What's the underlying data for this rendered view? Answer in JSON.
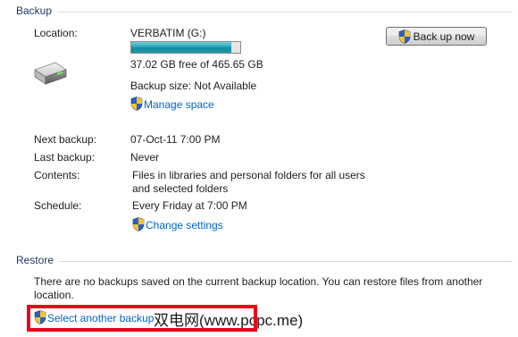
{
  "backup_section": {
    "title": "Backup",
    "location_label": "Location:",
    "drive_name": "VERBATIM (G:)",
    "free_space": "37.02 GB free of 465.65 GB",
    "usage_fraction": 0.92,
    "backup_size": "Backup size: Not Available",
    "manage_space_link": "Manage space",
    "backup_now_button": "Back up now",
    "next_backup_label": "Next backup:",
    "next_backup_value": "07-Oct-11 7:00 PM",
    "last_backup_label": "Last backup:",
    "last_backup_value": "Never",
    "contents_label": "Contents:",
    "contents_value_line1": "Files in libraries and personal folders for all users",
    "contents_value_line2": "and selected folders",
    "schedule_label": "Schedule:",
    "schedule_value": "Every Friday at 7:00 PM",
    "change_settings_link": "Change settings"
  },
  "restore_section": {
    "title": "Restore",
    "message_line1": "There are no backups saved on the current backup location. You can restore files from another",
    "message_line2": "location.",
    "select_backup_link": "Select another backup",
    "watermark": "双电网(www.pcpc.me)"
  },
  "colors": {
    "section_title": "#1e395b",
    "link": "#0066cc",
    "highlight_box": "#e8001c",
    "progress_fill": "#1b9aaa"
  },
  "icons": {
    "drive": "hard-drive-icon",
    "uac_shield": "uac-shield-icon"
  }
}
